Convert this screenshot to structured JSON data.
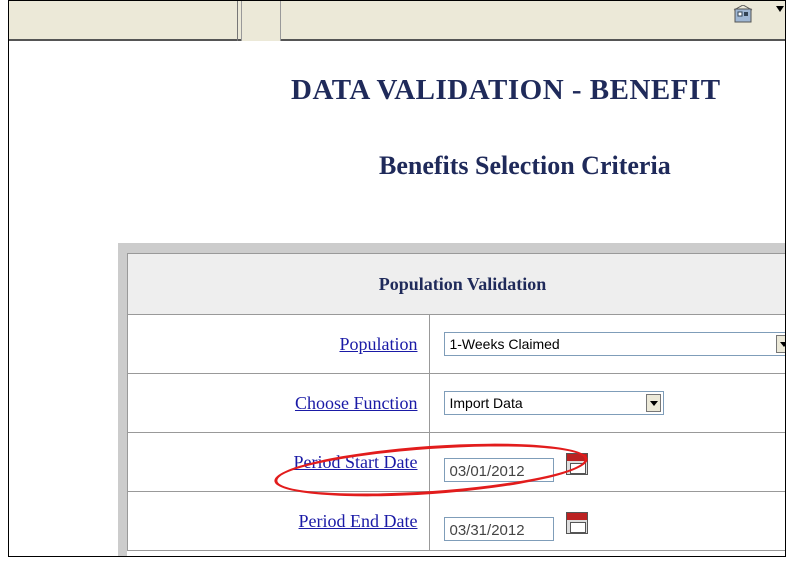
{
  "header": {
    "title": "DATA VALIDATION - BENEFIT",
    "subtitle": "Benefits Selection Criteria"
  },
  "form": {
    "section_title": "Population Validation",
    "rows": [
      {
        "label": "Population",
        "value": "1-Weeks Claimed"
      },
      {
        "label": "Choose Function",
        "value": "Import Data"
      },
      {
        "label": "Period Start Date",
        "value": "03/01/2012"
      },
      {
        "label": "Period End Date",
        "value": "03/31/2012"
      }
    ]
  },
  "annotation": {
    "color": "#e21c1c"
  },
  "icons": [
    "home-icon",
    "calendar-icon",
    "dropdown-arrow-icon"
  ]
}
